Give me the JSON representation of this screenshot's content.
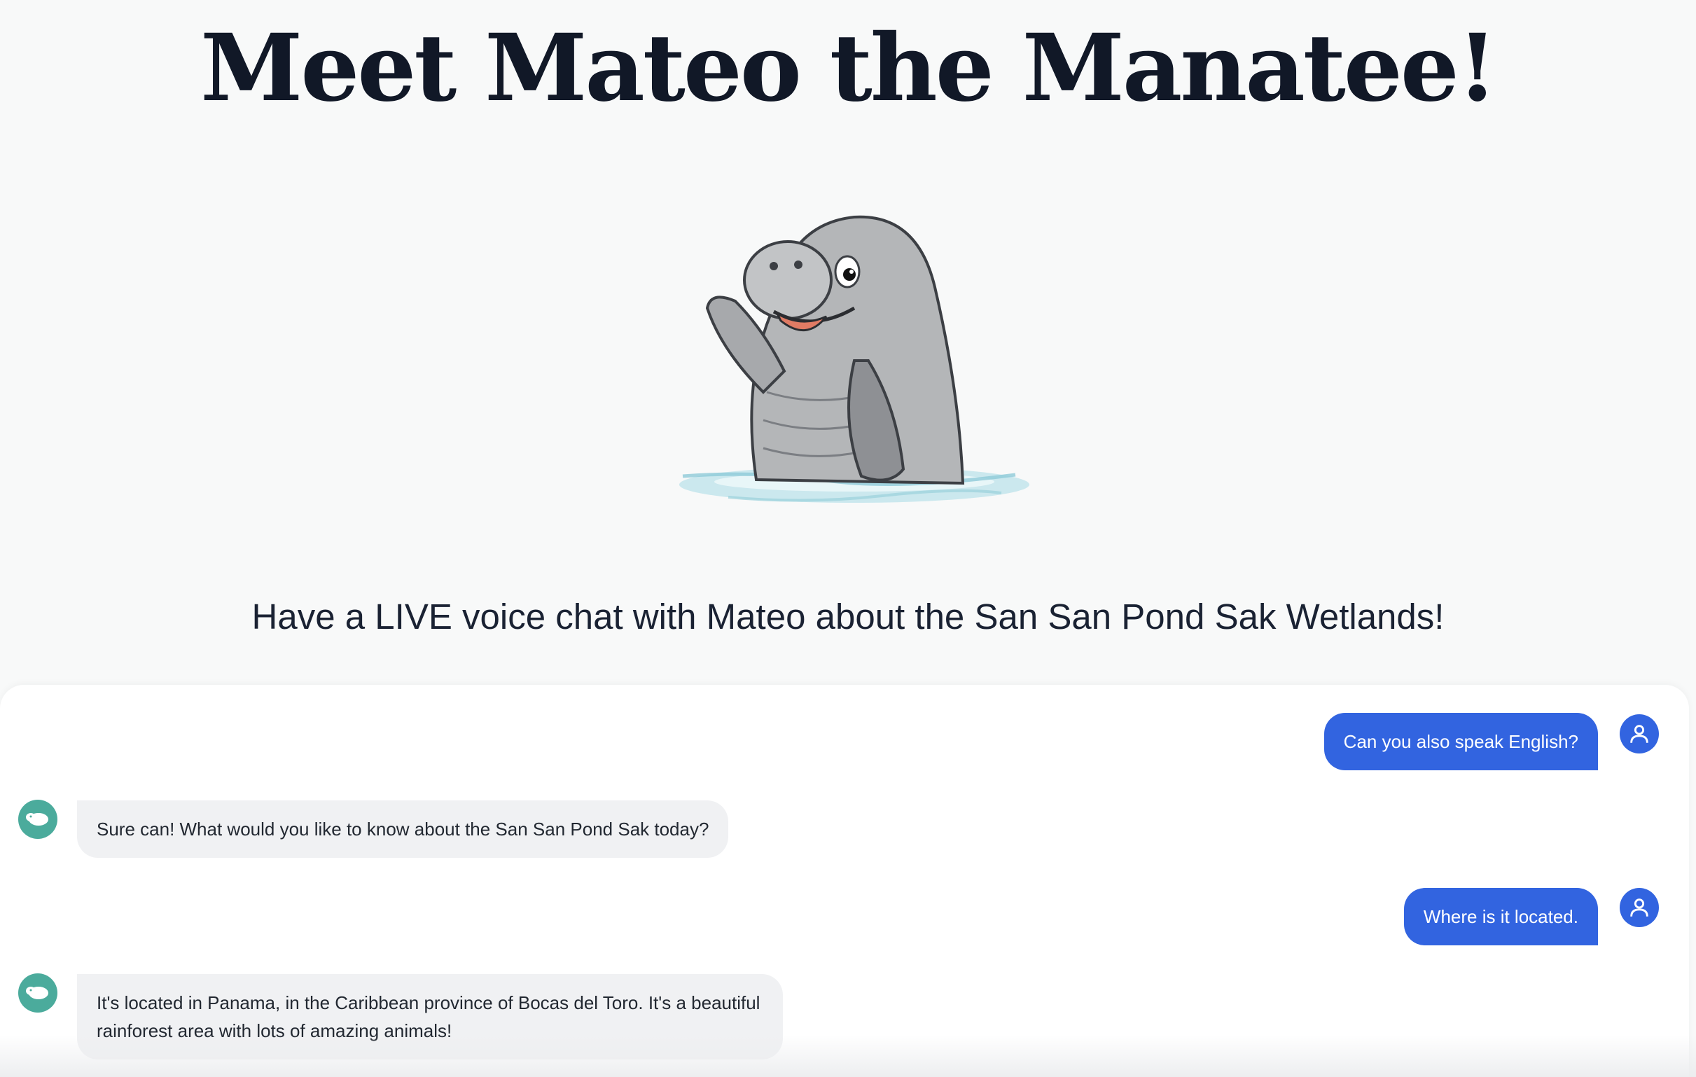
{
  "header": {
    "title": "Meet Mateo the Manatee!"
  },
  "mascot": {
    "icon": "manatee-waving-illustration",
    "colors": {
      "body": "#b4b6b8",
      "outline": "#3c3f44",
      "mouth": "#e07b64",
      "water": "#a8d8e2"
    }
  },
  "intro": {
    "subtitle": "Have a LIVE voice chat with Mateo about the San San Pond Sak Wetlands!"
  },
  "chat": {
    "colors": {
      "user_bubble": "#3264e0",
      "bot_bubble": "#f0f1f3",
      "bot_avatar": "#4bab9c"
    },
    "messages": [
      {
        "role": "user",
        "text": "Can you also speak English?",
        "icon": "user-icon"
      },
      {
        "role": "assistant",
        "text": "Sure can! What would you like to know about the San San Pond Sak today?",
        "icon": "manatee-icon"
      },
      {
        "role": "user",
        "text": "Where is it located.",
        "icon": "user-icon"
      },
      {
        "role": "assistant",
        "text": "It's located in Panama, in the Caribbean province of Bocas del Toro. It's a beautiful rainforest area with lots of amazing animals!",
        "icon": "manatee-icon"
      }
    ]
  }
}
